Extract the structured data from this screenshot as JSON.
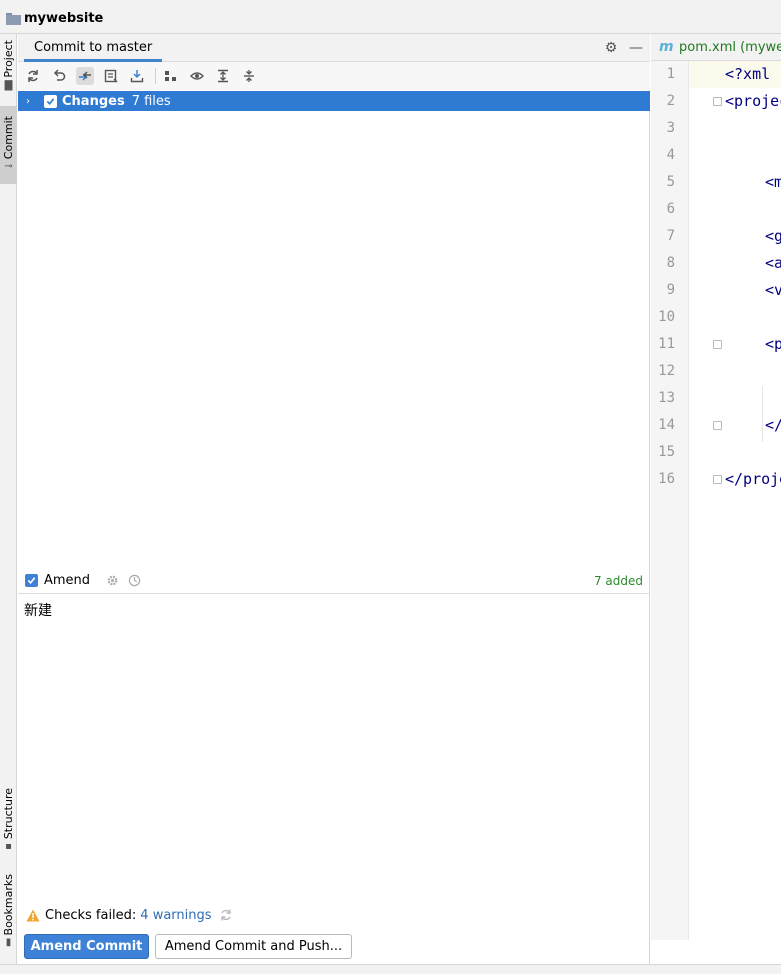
{
  "window": {
    "project_name": "mywebsite"
  },
  "left_strip": {
    "project_tab": "Project",
    "commit_tab": "Commit",
    "structure_tab": "Structure",
    "bookmarks_tab": "Bookmarks"
  },
  "commit_panel": {
    "tab_title": "Commit to master",
    "changes_label": "Changes",
    "changes_count": "7 files",
    "amend_label": "Amend",
    "added_count": "7 added",
    "commit_message": "新建",
    "checks_label": "Checks failed:",
    "checks_link": "4 warnings",
    "amend_commit_button": "Amend Commit",
    "amend_push_button": "Amend Commit and Push..."
  },
  "editor": {
    "tab_icon_letter": "m",
    "tab_name": "pom.xml (mywebsite)",
    "lines": [
      {
        "n": "1",
        "text": "<?xml",
        "indent": 0
      },
      {
        "n": "2",
        "text": "<project",
        "indent": 0
      },
      {
        "n": "3",
        "text": "",
        "indent": 0
      },
      {
        "n": "4",
        "text": "",
        "indent": 0
      },
      {
        "n": "5",
        "text": "<m",
        "indent": 1
      },
      {
        "n": "6",
        "text": "",
        "indent": 0
      },
      {
        "n": "7",
        "text": "<g",
        "indent": 1
      },
      {
        "n": "8",
        "text": "<a",
        "indent": 1
      },
      {
        "n": "9",
        "text": "<v",
        "indent": 1
      },
      {
        "n": "10",
        "text": "",
        "indent": 0
      },
      {
        "n": "11",
        "text": "<p",
        "indent": 1
      },
      {
        "n": "12",
        "text": "",
        "indent": 0
      },
      {
        "n": "13",
        "text": "",
        "indent": 0
      },
      {
        "n": "14",
        "text": "</",
        "indent": 1
      },
      {
        "n": "15",
        "text": "",
        "indent": 0
      },
      {
        "n": "16",
        "text": "</project",
        "indent": 0
      }
    ]
  },
  "colors": {
    "accent": "#3d82d6",
    "selection": "#2f7ad3",
    "added": "#2d8a2d",
    "link": "#2f6db5"
  }
}
